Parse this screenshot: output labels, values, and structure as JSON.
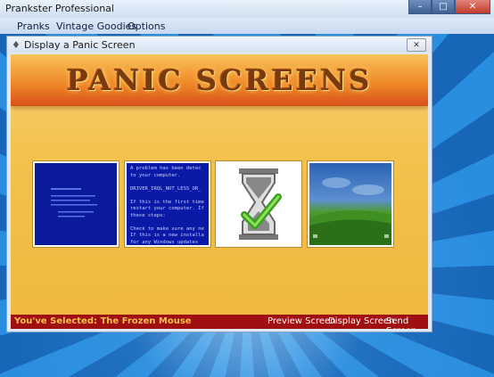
{
  "window": {
    "title": "Prankster Professional",
    "minimize": "–",
    "maximize": "□",
    "close": "✕"
  },
  "menu": [
    "Pranks",
    "Vintage Goodies",
    "Options"
  ],
  "dialog": {
    "title": "Display a Panic Screen",
    "close": "✕"
  },
  "banner": "PANIC SCREENS",
  "thumbnails": [
    {
      "name": "blue-screen"
    },
    {
      "name": "bsod-text",
      "text": "A problem has been detec\nto your computer.\n\nDRIVER_IRQL_NOT_LESS_OR_\n\nIf this is the first time\nrestart your computer. If\nthese steps:\n\nCheck to make sure any ne\nIf this is a new installa\nfor any Windows updates"
    },
    {
      "name": "frozen-mouse"
    },
    {
      "name": "desktop-wallpaper"
    }
  ],
  "status": {
    "selected": "You've Selected: The Frozen Mouse",
    "actions": [
      "Preview Screen",
      "Display Screen",
      "Send Screen"
    ]
  }
}
